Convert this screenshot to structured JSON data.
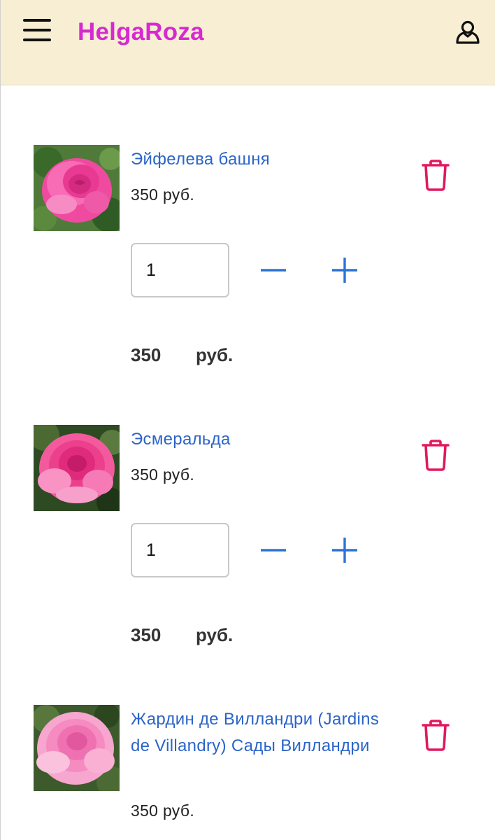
{
  "header": {
    "brand": "HelgaRoza",
    "menu_icon": "hamburger-menu-icon",
    "user_icon": "user-icon",
    "background": "#f7eed3",
    "brand_color": "#d62ad0"
  },
  "cart": {
    "items": [
      {
        "name": "Эйфелева башня",
        "price": "350 руб.",
        "quantity": "1",
        "total_value": "350",
        "total_currency": "руб."
      },
      {
        "name": "Эсмеральда",
        "price": "350 руб.",
        "quantity": "1",
        "total_value": "350",
        "total_currency": "руб."
      },
      {
        "name": "Жардин де Вилландри (Jardins de Villandry) Сады Вилландри",
        "price": "350 руб."
      }
    ]
  },
  "colors": {
    "link": "#2b64c8",
    "trash": "#e0195f",
    "stepper": "#2b74d6"
  }
}
